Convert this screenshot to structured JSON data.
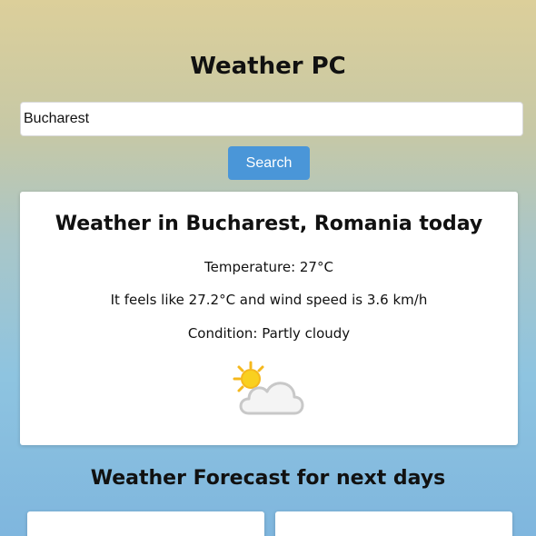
{
  "app": {
    "title": "Weather PC"
  },
  "search": {
    "value": "Bucharest",
    "button_label": "Search"
  },
  "current": {
    "heading": "Weather in Bucharest, Romania today",
    "temperature": "Temperature: 27°C",
    "feels_like": "It feels like 27.2°C and wind speed is 3.6 km/h",
    "condition": "Condition: Partly cloudy",
    "icon": "partly-cloudy-icon"
  },
  "forecast": {
    "title": "Weather Forecast for next days"
  },
  "colors": {
    "button": "#4a96d8",
    "background_top": "#dccf9a",
    "background_bottom": "#7fb6de"
  }
}
